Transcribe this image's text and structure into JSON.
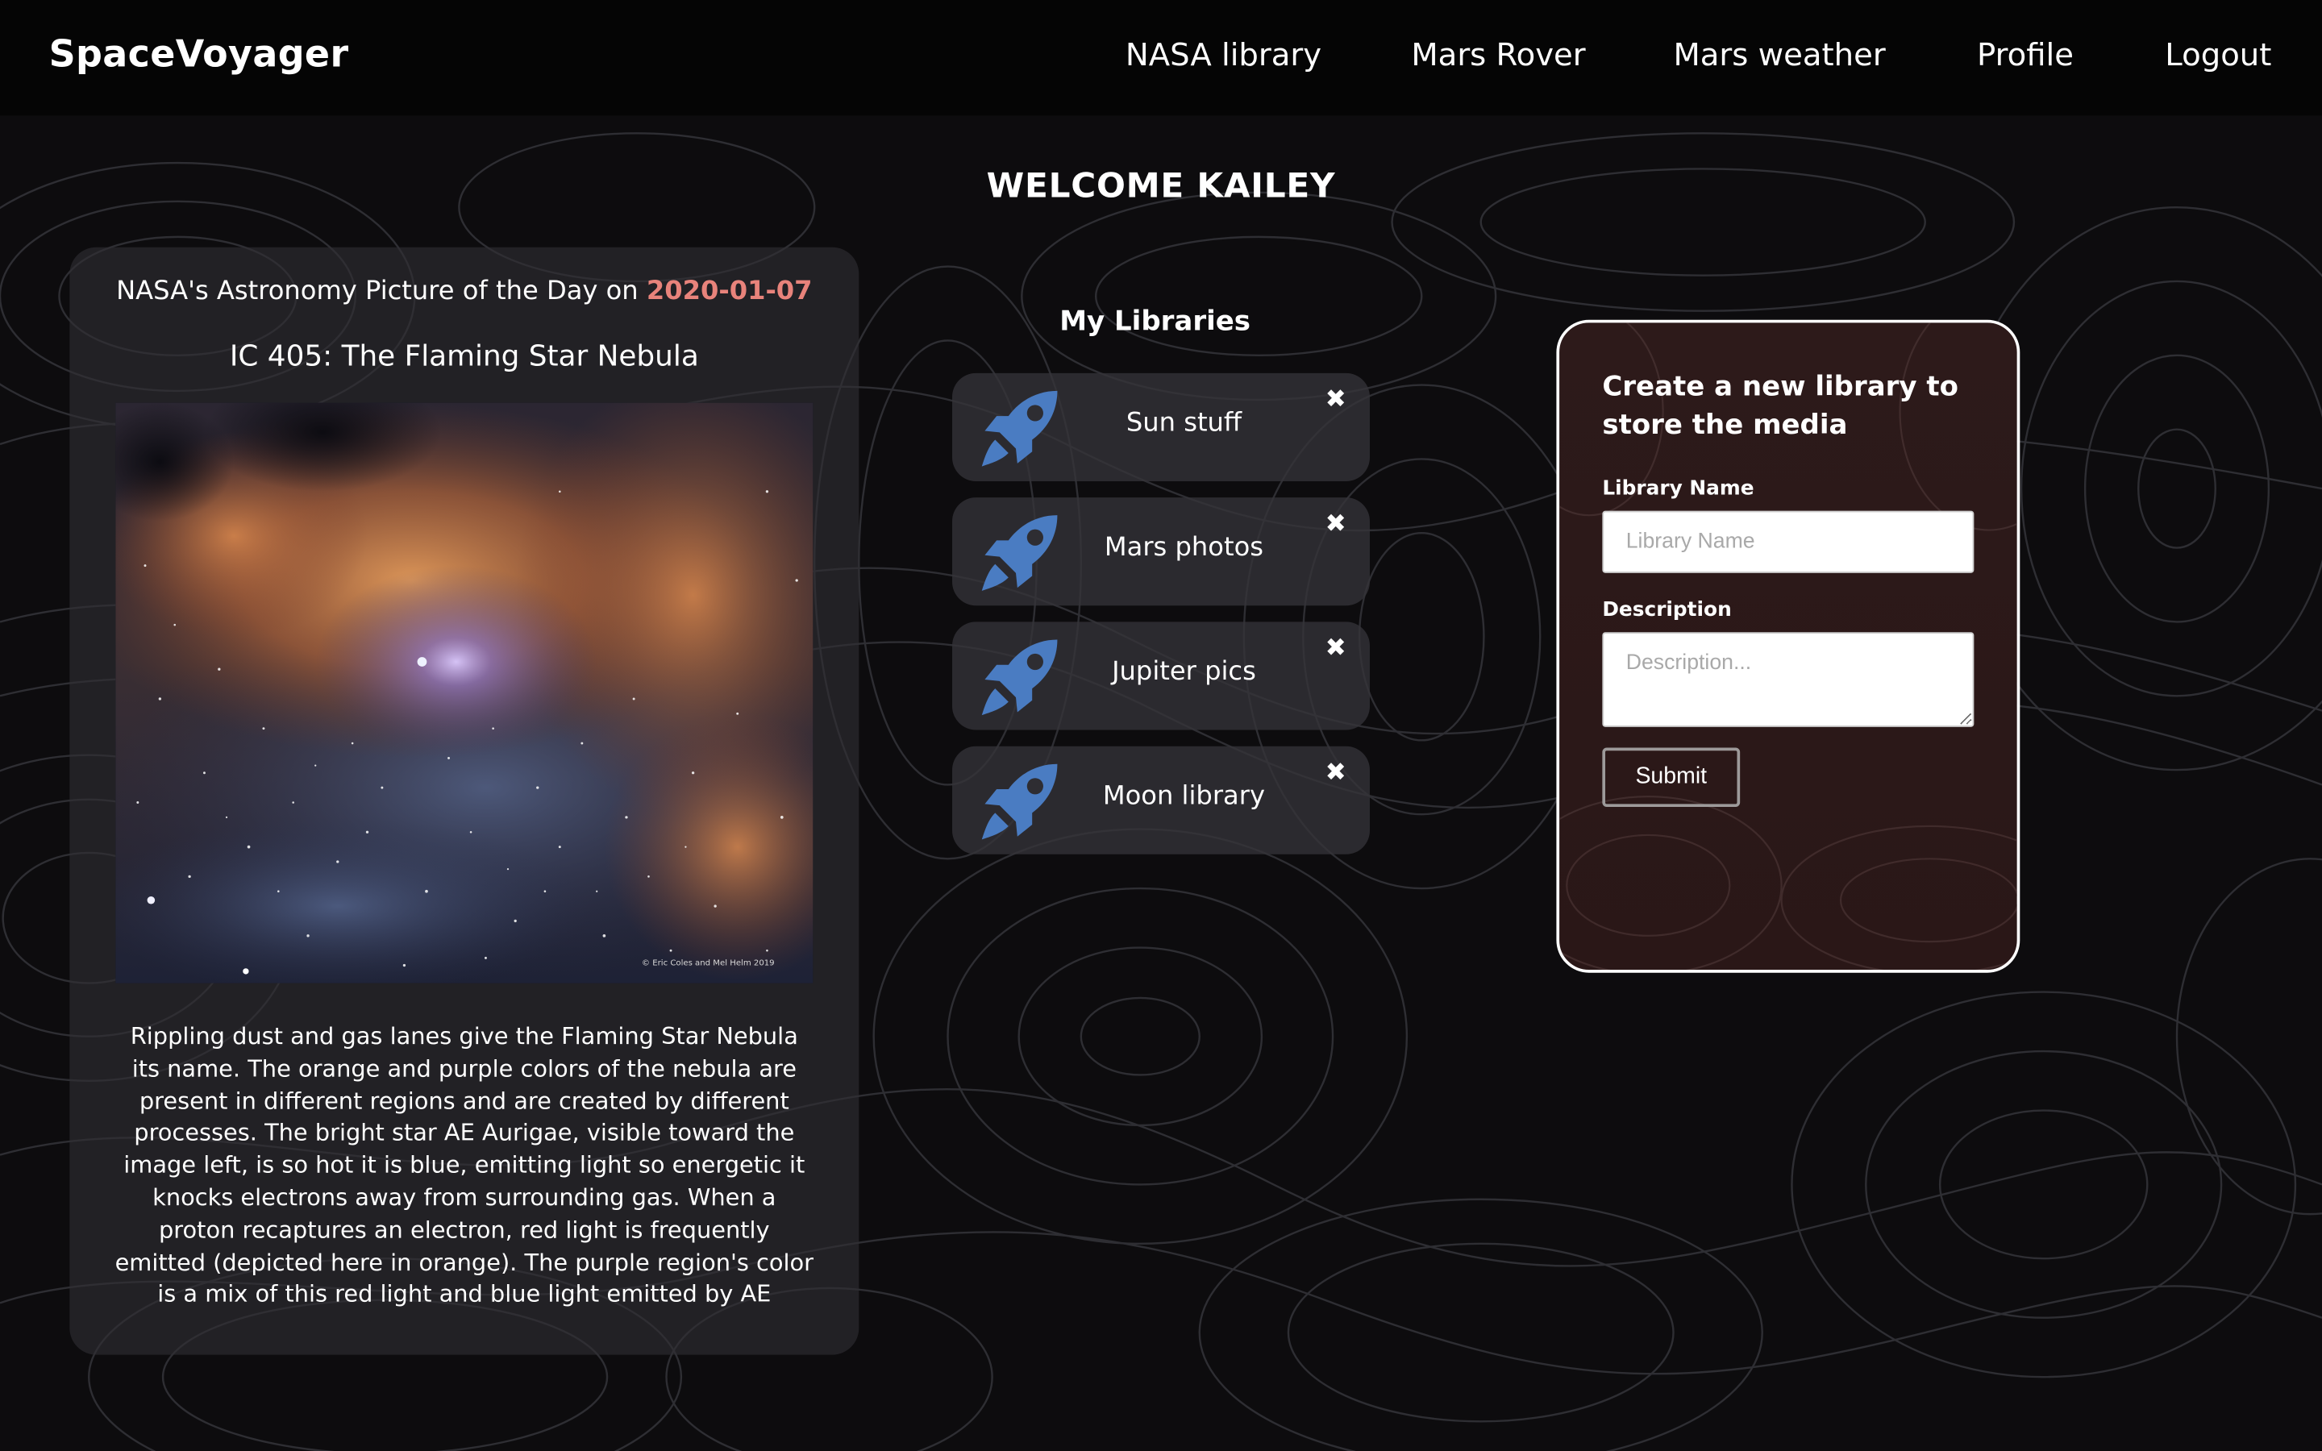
{
  "nav": {
    "brand": "SpaceVoyager",
    "links": [
      "NASA library",
      "Mars Rover",
      "Mars weather",
      "Profile",
      "Logout"
    ]
  },
  "welcome": "WELCOME KAILEY",
  "apod": {
    "heading_prefix": "NASA's Astronomy Picture of the Day on ",
    "date": "2020-01-07",
    "title": "IC 405: The Flaming Star Nebula",
    "image_credit": "© Eric Coles and Mel Helm 2019",
    "description": "Rippling dust and gas lanes give the Flaming Star Nebula its name. The orange and purple colors of the nebula are present in different regions and are created by different processes. The bright star AE Aurigae, visible toward the image left, is so hot it is blue, emitting light so energetic it knocks electrons away from surrounding gas. When a proton recaptures an electron, red light is frequently emitted (depicted here in orange). The purple region's color is a mix of this red light and blue light emitted by AE"
  },
  "libraries": {
    "heading": "My Libraries",
    "items": [
      {
        "name": "Sun stuff",
        "delete": "✖"
      },
      {
        "name": "Mars photos",
        "delete": "✖"
      },
      {
        "name": "Jupiter pics",
        "delete": "✖"
      },
      {
        "name": "Moon library",
        "delete": "✖"
      }
    ],
    "icon": "rocket-icon",
    "icon_color": "#4a7cc2"
  },
  "form": {
    "title": "Create a new library to store the media",
    "name_label": "Library Name",
    "name_placeholder": "Library Name",
    "description_label": "Description",
    "description_placeholder": "Description...",
    "submit_label": "Submit"
  },
  "colors": {
    "date_accent": "#e8837b",
    "background": "#0d0c0e",
    "card": "#302f34",
    "form_bg": "#2d1a1a"
  }
}
